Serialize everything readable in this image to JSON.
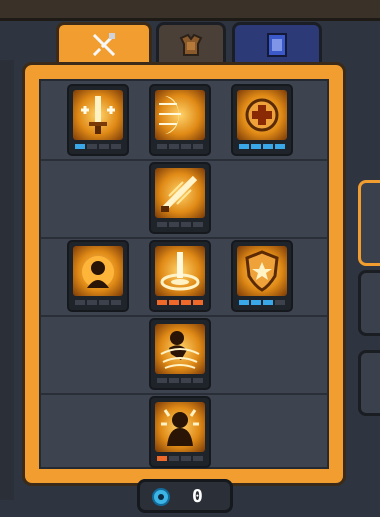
{
  "tabs": [
    {
      "icon": "crossed-swords-icon",
      "active": true
    },
    {
      "icon": "armor-icon",
      "active": false
    },
    {
      "icon": "banner-icon",
      "active": false
    }
  ],
  "skill_tree": {
    "rows": [
      [
        {
          "name": "sword-buff-icon",
          "level": 1,
          "max": 4,
          "pip_color": "#3aa7e8"
        },
        {
          "name": "crescent-slash-icon",
          "level": 0,
          "max": 4,
          "pip_color": "#3aa7e8"
        },
        {
          "name": "heal-cross-icon",
          "level": 4,
          "max": 4,
          "pip_color": "#3aa7e8"
        }
      ],
      [
        {
          "name": "sword-dash-icon",
          "level": 0,
          "max": 4,
          "pip_color": "#3aa7e8"
        }
      ],
      [
        {
          "name": "flame-aura-icon",
          "level": 0,
          "max": 4,
          "pip_color": "#3aa7e8"
        },
        {
          "name": "ground-strike-icon",
          "level": 4,
          "max": 4,
          "pip_color": "#ef6a2a"
        },
        {
          "name": "shield-star-icon",
          "level": 3,
          "max": 4,
          "pip_color": "#3aa7e8"
        }
      ],
      [
        {
          "name": "whirlwind-icon",
          "level": 0,
          "max": 4,
          "pip_color": "#3aa7e8"
        }
      ],
      [
        {
          "name": "rage-burst-icon",
          "level": 1,
          "max": 4,
          "pip_color": "#ef6a2a"
        }
      ]
    ]
  },
  "currency": {
    "icon": "swirl-gem-icon",
    "value": "0"
  },
  "colors": {
    "panel_orange": "#f19d2f",
    "pip_blue": "#3aa7e8",
    "pip_orange": "#ef6a2a"
  }
}
